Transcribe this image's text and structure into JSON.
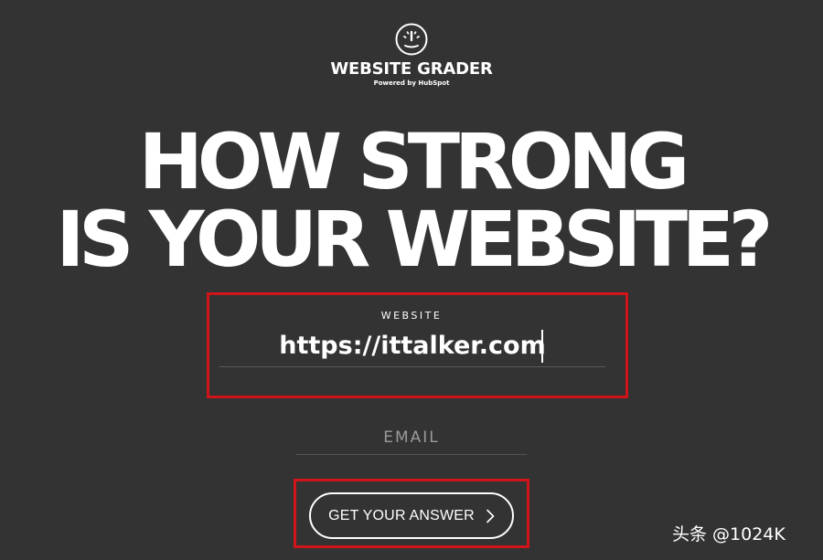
{
  "logo": {
    "icon": "speedometer-icon",
    "title": "WEBSITE GRADER",
    "subtitle": "Powered by HubSpot"
  },
  "headline": {
    "line1": "HOW STRONG",
    "line2": "IS YOUR WEBSITE?"
  },
  "form": {
    "website": {
      "label": "WEBSITE",
      "value": "https://ittalker.com"
    },
    "email": {
      "placeholder": "EMAIL",
      "value": ""
    },
    "submit": {
      "label": "GET YOUR ANSWER",
      "icon": "chevron-right-icon"
    }
  },
  "watermark": "头条 @1024K",
  "colors": {
    "background": "#333333",
    "text": "#ffffff",
    "highlight": "#d0141a"
  }
}
